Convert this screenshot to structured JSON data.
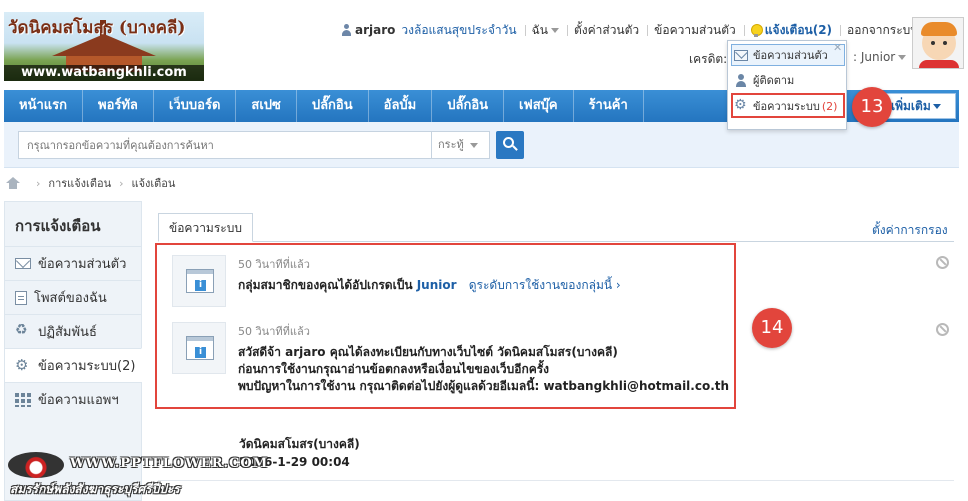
{
  "site": {
    "logo_title": "วัดนิคมสโมสร (บางคลี)",
    "logo_url": "www.watbangkhli.com"
  },
  "topbar": {
    "username": "arjaro",
    "daily_link": "วงล้อแสนสุขประจำวัน",
    "me_menu": "ฉัน",
    "settings": "ตั้งค่าส่วนตัว",
    "private_messages": "ข้อความส่วนตัว",
    "notifications": "แจ้งเตือน(2)",
    "logout": "ออกจากระบบ",
    "credit_label": "เครดิต:",
    "rank": "Junior"
  },
  "notify_dropdown": {
    "items": [
      {
        "label": "ข้อความส่วนตัว",
        "count": ""
      },
      {
        "label": "ผู้ติดตาม",
        "count": ""
      },
      {
        "label": "ข้อความระบบ",
        "count": "(2)"
      }
    ]
  },
  "nav": {
    "items": [
      "หน้าแรก",
      "พอร์ทัล",
      "เว็บบอร์ด",
      "สเปซ",
      "ปลั๊กอิน",
      "อัลบั้ม",
      "ปลั๊กอิน",
      "เฟสบุ๊ค",
      "ร้านค้า"
    ],
    "more": "เพิ่มเติม"
  },
  "search": {
    "placeholder": "กรุณากรอกข้อความที่คุณต้องการค้นหา",
    "scope": "กระทู้"
  },
  "breadcrumb": [
    "การแจ้งเตือน",
    "แจ้งเตือน"
  ],
  "sidebar": {
    "title": "การแจ้งเตือน",
    "items": [
      "ข้อความส่วนตัว",
      "โพสต์ของฉัน",
      "ปฏิสัมพันธ์",
      "ข้อความระบบ(2)",
      "ข้อความแอพฯ"
    ]
  },
  "main": {
    "tab": "ข้อความระบบ",
    "filter_settings": "ตั้งค่าการกรอง",
    "notices": [
      {
        "time": "50 วินาทีที่แล้ว",
        "line1_prefix": "กลุ่มสมาชิกของคุณได้อัปเกรดเป็น",
        "line1_group": "Junior",
        "line1_link": "ดูระดับการใช้งานของกลุ่มนี้ ›"
      },
      {
        "time": "50 วินาทีที่แล้ว",
        "line1": "สวัสดีจ้า arjaro คุณได้ลงทะเบียนกับทางเว็บไซต์ วัดนิคมสโมสร(บางคลี)",
        "line2": "ก่อนการใช้งานกรุณาอ่านข้อตกลงหรือเงื่อนไขของเว็บอีกครั้ง",
        "line3": "พบปัญหาในการใช้งาน กรุณาติดต่อไปยังผู้ดูแลด้วยอีเมลนี้: watbangkhli@hotmail.co.th"
      }
    ],
    "sign_name": "วัดนิคมสโมสร(บางคลี)",
    "sign_date": "2016-1-29 00:04"
  },
  "annotations": {
    "badge_13": "13",
    "badge_14": "14"
  },
  "watermark": {
    "url": "WWW.PPTFLOWER.COM",
    "subtitle": "สมรรักษ์พลังสังฆาธุระบุรีศรีปีปะร"
  },
  "colors": {
    "nav_blue": "#2a7fcb",
    "link_blue": "#1d5fa6",
    "highlight_red": "#e2453c",
    "sidebar_bg": "#eef3f8"
  }
}
